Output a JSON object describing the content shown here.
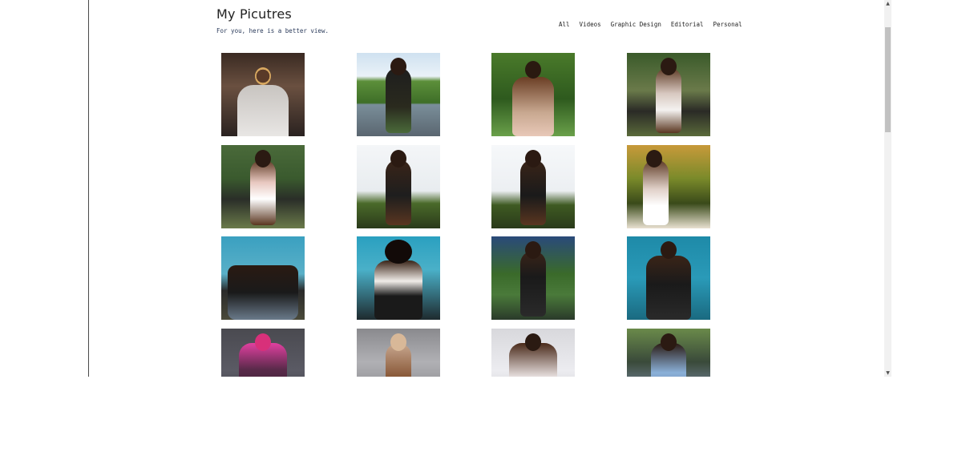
{
  "header": {
    "title": "My Picutres",
    "subtitle": "For you, here is a better view."
  },
  "nav": {
    "items": [
      {
        "label": "All"
      },
      {
        "label": "Videos"
      },
      {
        "label": "Graphic Design"
      },
      {
        "label": "Editorial"
      },
      {
        "label": "Personal"
      }
    ]
  },
  "gallery": {
    "photos": [
      {
        "name": "photo-1"
      },
      {
        "name": "photo-2"
      },
      {
        "name": "photo-3"
      },
      {
        "name": "photo-4"
      },
      {
        "name": "photo-5"
      },
      {
        "name": "photo-6"
      },
      {
        "name": "photo-7"
      },
      {
        "name": "photo-8"
      },
      {
        "name": "photo-9"
      },
      {
        "name": "photo-10"
      },
      {
        "name": "photo-11"
      },
      {
        "name": "photo-12"
      },
      {
        "name": "photo-13"
      },
      {
        "name": "photo-14"
      },
      {
        "name": "photo-15"
      },
      {
        "name": "photo-16"
      }
    ]
  },
  "scrollbar": {
    "up_icon": "triangle-up-icon",
    "down_icon": "triangle-down-icon",
    "up_glyph": "▲",
    "down_glyph": "▼"
  }
}
